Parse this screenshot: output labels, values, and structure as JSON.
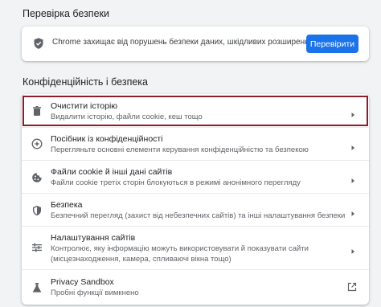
{
  "safety_check": {
    "title": "Перевірка безпеки",
    "text": "Chrome захищає від порушень безпеки даних, шкідливих розширень тощо",
    "button_label": "Перевірити"
  },
  "privacy": {
    "title": "Конфіденційність і безпека",
    "items": [
      {
        "title": "Очистити історію",
        "subtitle": "Видалити історію, файли cookie, кеш тощо",
        "icon": "trash-icon",
        "highlighted": true
      },
      {
        "title": "Посібник із конфіденційності",
        "subtitle": "Перегляньте основні елементи керування конфіденційністю та безпекою",
        "icon": "compass-icon"
      },
      {
        "title": "Файли cookie й інші дані сайтів",
        "subtitle": "Файли cookie третіх сторін блокуються в режимі анонімного перегляду",
        "icon": "cookie-icon"
      },
      {
        "title": "Безпека",
        "subtitle": "Безпечний перегляд (захист від небезпечних сайтів) та інші налаштування безпеки",
        "icon": "shield-icon"
      },
      {
        "title": "Налаштування сайтів",
        "subtitle_line1": "Контролює, яку інформацію можуть використовувати й показувати сайти",
        "subtitle_line2": "(місцезнаходження, камера, спливаючі вікна тощо)",
        "icon": "sliders-icon"
      },
      {
        "title": "Privacy Sandbox",
        "subtitle": "Пробні функції вимкнено",
        "icon": "flask-icon"
      }
    ]
  },
  "colors": {
    "accent": "#1a73e8",
    "highlight_border": "#8b1c2c"
  }
}
